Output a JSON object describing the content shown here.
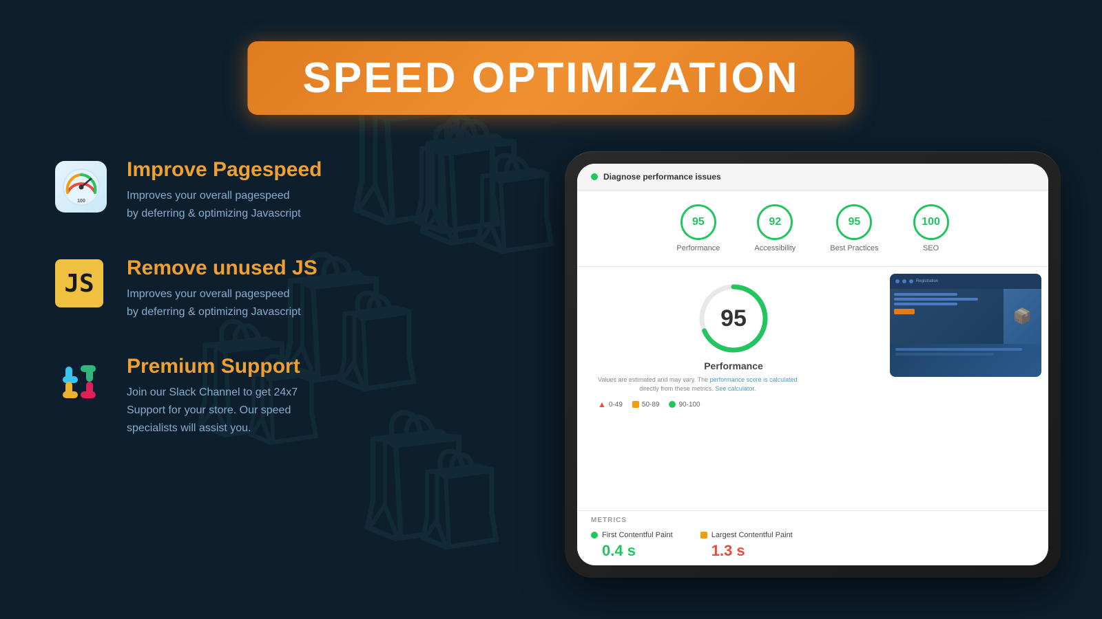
{
  "header": {
    "title": "SPEED OPTIMIZATION"
  },
  "features": [
    {
      "id": "pagespeed",
      "icon_type": "gauge",
      "title": "Improve Pagespeed",
      "description_line1": "Improves your overall pagespeed",
      "description_line2": "by deferring & optimizing Javascript"
    },
    {
      "id": "unused-js",
      "icon_type": "js",
      "title": "Remove unused JS",
      "description_line1": "Improves your overall pagespeed",
      "description_line2": "by deferring & optimizing Javascript"
    },
    {
      "id": "support",
      "icon_type": "slack",
      "title": "Premium Support",
      "description_line1": "Join our Slack Channel to get 24x7",
      "description_line2": "Support for your store. Our speed",
      "description_line3": "specialists will assist you."
    }
  ],
  "dashboard": {
    "header_dot_color": "#22c55e",
    "header_text": "Diagnose performance issues",
    "scores": [
      {
        "value": "95",
        "label": "Performance"
      },
      {
        "value": "92",
        "label": "Accessibility"
      },
      {
        "value": "95",
        "label": "Best Practices"
      },
      {
        "value": "100",
        "label": "SEO"
      }
    ],
    "big_score": {
      "value": "95",
      "label": "Performance",
      "note": "Values are estimated and may vary. The performance score is calculated\ndirectly from these metrics. See calculator.",
      "legend": [
        {
          "type": "triangle",
          "color": "red",
          "range": "0-49"
        },
        {
          "type": "square",
          "color": "orange",
          "range": "50-89"
        },
        {
          "type": "circle",
          "color": "green",
          "range": "90-100"
        }
      ]
    },
    "metrics": {
      "title": "METRICS",
      "items": [
        {
          "label": "First Contentful Paint",
          "value": "0.4 s",
          "dot_color": "green",
          "value_color": "green"
        },
        {
          "label": "Largest Contentful Paint",
          "value": "1.3 s",
          "dot_color": "orange",
          "value_color": "red"
        }
      ]
    }
  },
  "colors": {
    "background": "#0d1f2d",
    "accent_orange": "#f0a030",
    "accent_green": "#22c55e",
    "text_muted": "#8aaccc"
  }
}
